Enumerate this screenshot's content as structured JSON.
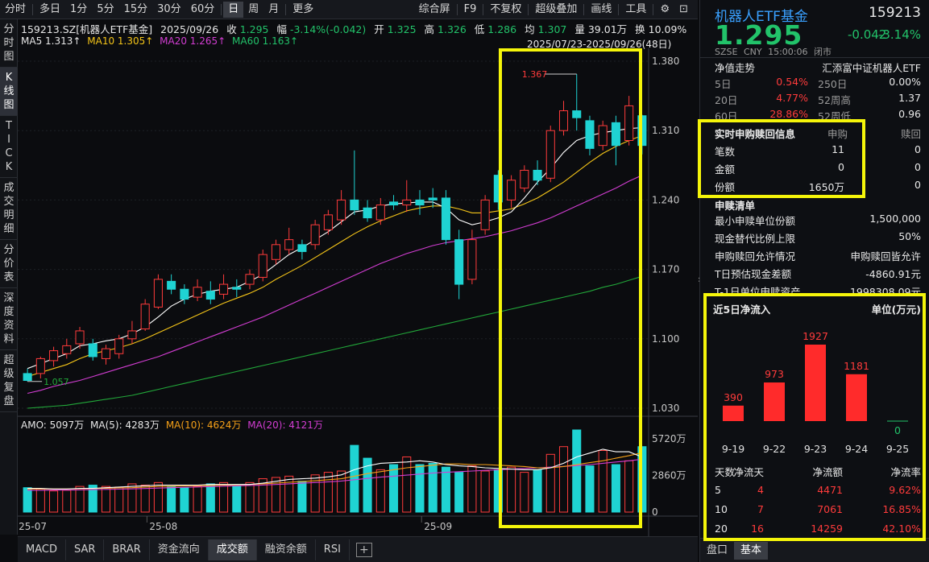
{
  "toolbar": {
    "periods": [
      "分时",
      "多日",
      "1分",
      "5分",
      "15分",
      "30分",
      "60分",
      "日",
      "周",
      "月",
      "更多"
    ],
    "active_period": "日",
    "right_items": [
      "综合屏",
      "F9",
      "不复权",
      "超级叠加",
      "画线",
      "工具"
    ]
  },
  "vtabs": [
    "分时图",
    "K线图",
    "TICK",
    "成交明细",
    "分价表",
    "深度资料",
    "超级复盘"
  ],
  "quote_line": {
    "code_name": "159213.SZ[机器人ETF基金]",
    "date": "2025/09/26",
    "close_label": "收",
    "close": "1.295",
    "chg_label": "幅",
    "chg": "-3.14%(-0.042)",
    "open_label": "开",
    "open": "1.325",
    "high_label": "高",
    "high": "1.326",
    "low_label": "低",
    "low": "1.286",
    "avg_label": "均",
    "avg": "1.307",
    "vol_label": "量",
    "vol": "39.01万",
    "turnover_label": "换",
    "turnover": "10.09%"
  },
  "ma_line": {
    "ma5": "MA5 1.313↑",
    "ma10": "MA10 1.305↑",
    "ma20": "MA20 1.265↑",
    "ma60": "MA60 1.163↑",
    "range": "2025/07/23-2025/09/26(48日)"
  },
  "price_axis": [
    "1.380",
    "1.310",
    "1.240",
    "1.170",
    "1.100",
    "1.030"
  ],
  "annotations": {
    "high": "1.367",
    "low": "1.057"
  },
  "amo_line": {
    "amo": "AMO: 5097万",
    "ma5": "MA(5): 4283万",
    "ma10": "MA(10): 4624万",
    "ma20": "MA(20): 4121万"
  },
  "vol_axis": [
    "5720万",
    "2860万",
    "0"
  ],
  "date_axis": [
    "25-07",
    "25-08",
    "25-09"
  ],
  "bottom_tabs": [
    "MACD",
    "SAR",
    "BRAR",
    "资金流向",
    "成交额",
    "融资余额",
    "RSI"
  ],
  "active_bottom_tab": "成交额",
  "colors": {
    "up": "#ff3b3b",
    "down": "#1fd3d3",
    "ma5": "#ffffff",
    "ma10": "#f5c518",
    "ma20": "#d23dd2",
    "ma60": "#22a83a",
    "highlight": "#f5f50a"
  },
  "chart_data": {
    "type": "candlestick",
    "ylim": [
      1.03,
      1.38
    ],
    "candles": [
      {
        "o": 1.065,
        "c": 1.058,
        "h": 1.07,
        "l": 1.057
      },
      {
        "o": 1.065,
        "c": 1.08,
        "h": 1.082,
        "l": 1.06
      },
      {
        "o": 1.078,
        "c": 1.088,
        "h": 1.092,
        "l": 1.072
      },
      {
        "o": 1.085,
        "c": 1.093,
        "h": 1.1,
        "l": 1.08
      },
      {
        "o": 1.095,
        "c": 1.108,
        "h": 1.112,
        "l": 1.09
      },
      {
        "o": 1.095,
        "c": 1.082,
        "h": 1.1,
        "l": 1.078
      },
      {
        "o": 1.08,
        "c": 1.09,
        "h": 1.094,
        "l": 1.074
      },
      {
        "o": 1.085,
        "c": 1.1,
        "h": 1.104,
        "l": 1.08
      },
      {
        "o": 1.1,
        "c": 1.108,
        "h": 1.118,
        "l": 1.095
      },
      {
        "o": 1.11,
        "c": 1.135,
        "h": 1.14,
        "l": 1.108
      },
      {
        "o": 1.132,
        "c": 1.16,
        "h": 1.165,
        "l": 1.13
      },
      {
        "o": 1.158,
        "c": 1.15,
        "h": 1.165,
        "l": 1.145
      },
      {
        "o": 1.15,
        "c": 1.14,
        "h": 1.155,
        "l": 1.135
      },
      {
        "o": 1.142,
        "c": 1.152,
        "h": 1.16,
        "l": 1.138
      },
      {
        "o": 1.148,
        "c": 1.14,
        "h": 1.158,
        "l": 1.135
      },
      {
        "o": 1.145,
        "c": 1.155,
        "h": 1.165,
        "l": 1.14
      },
      {
        "o": 1.152,
        "c": 1.15,
        "h": 1.16,
        "l": 1.142
      },
      {
        "o": 1.155,
        "c": 1.165,
        "h": 1.17,
        "l": 1.15
      },
      {
        "o": 1.162,
        "c": 1.185,
        "h": 1.19,
        "l": 1.158
      },
      {
        "o": 1.18,
        "c": 1.195,
        "h": 1.2,
        "l": 1.175
      },
      {
        "o": 1.19,
        "c": 1.2,
        "h": 1.212,
        "l": 1.185
      },
      {
        "o": 1.195,
        "c": 1.188,
        "h": 1.2,
        "l": 1.18
      },
      {
        "o": 1.195,
        "c": 1.215,
        "h": 1.22,
        "l": 1.19
      },
      {
        "o": 1.21,
        "c": 1.225,
        "h": 1.23,
        "l": 1.205
      },
      {
        "o": 1.22,
        "c": 1.24,
        "h": 1.25,
        "l": 1.215
      },
      {
        "o": 1.24,
        "c": 1.23,
        "h": 1.29,
        "l": 1.225
      },
      {
        "o": 1.232,
        "c": 1.222,
        "h": 1.24,
        "l": 1.218
      },
      {
        "o": 1.22,
        "c": 1.235,
        "h": 1.242,
        "l": 1.215
      },
      {
        "o": 1.238,
        "c": 1.235,
        "h": 1.245,
        "l": 1.23
      },
      {
        "o": 1.235,
        "c": 1.24,
        "h": 1.26,
        "l": 1.228
      },
      {
        "o": 1.24,
        "c": 1.235,
        "h": 1.25,
        "l": 1.225
      },
      {
        "o": 1.242,
        "c": 1.24,
        "h": 1.252,
        "l": 1.232
      },
      {
        "o": 1.242,
        "c": 1.2,
        "h": 1.25,
        "l": 1.195
      },
      {
        "o": 1.2,
        "c": 1.155,
        "h": 1.21,
        "l": 1.14
      },
      {
        "o": 1.16,
        "c": 1.2,
        "h": 1.21,
        "l": 1.155
      },
      {
        "o": 1.21,
        "c": 1.24,
        "h": 1.245,
        "l": 1.205
      },
      {
        "o": 1.265,
        "c": 1.238,
        "h": 1.27,
        "l": 1.23
      },
      {
        "o": 1.24,
        "c": 1.26,
        "h": 1.265,
        "l": 1.232
      },
      {
        "o": 1.252,
        "c": 1.27,
        "h": 1.275,
        "l": 1.248
      },
      {
        "o": 1.27,
        "c": 1.26,
        "h": 1.28,
        "l": 1.255
      },
      {
        "o": 1.262,
        "c": 1.31,
        "h": 1.315,
        "l": 1.258
      },
      {
        "o": 1.31,
        "c": 1.33,
        "h": 1.34,
        "l": 1.305
      },
      {
        "o": 1.33,
        "c": 1.323,
        "h": 1.367,
        "l": 1.31
      },
      {
        "o": 1.32,
        "c": 1.292,
        "h": 1.325,
        "l": 1.285
      },
      {
        "o": 1.295,
        "c": 1.315,
        "h": 1.32,
        "l": 1.29
      },
      {
        "o": 1.318,
        "c": 1.295,
        "h": 1.325,
        "l": 1.275
      },
      {
        "o": 1.3,
        "c": 1.335,
        "h": 1.345,
        "l": 1.295
      },
      {
        "o": 1.325,
        "c": 1.295,
        "h": 1.326,
        "l": 1.286
      }
    ],
    "amount_wan": [
      1900,
      1800,
      1650,
      1700,
      2000,
      2100,
      2000,
      1950,
      2200,
      2100,
      2300,
      2000,
      1900,
      2000,
      2200,
      2300,
      2050,
      2300,
      2600,
      2700,
      2800,
      2400,
      2900,
      3100,
      3200,
      5200,
      4200,
      3300,
      3700,
      4300,
      3700,
      3800,
      3500,
      3100,
      3600,
      3200,
      3300,
      3500,
      3100,
      3300,
      4500,
      5100,
      6400,
      3600,
      4800,
      3700,
      4000,
      5100
    ],
    "ma5": [
      1.07,
      1.075,
      1.08,
      1.085,
      1.093,
      1.095,
      1.098,
      1.1,
      1.105,
      1.112,
      1.122,
      1.133,
      1.14,
      1.145,
      1.148,
      1.15,
      1.152,
      1.158,
      1.165,
      1.175,
      1.185,
      1.192,
      1.2,
      1.208,
      1.218,
      1.228,
      1.23,
      1.234,
      1.236,
      1.237,
      1.238,
      1.238,
      1.232,
      1.22,
      1.215,
      1.218,
      1.222,
      1.228,
      1.242,
      1.258,
      1.272,
      1.288,
      1.3,
      1.305,
      1.308,
      1.31,
      1.312,
      1.313
    ],
    "ma10": [
      1.062,
      1.066,
      1.07,
      1.074,
      1.08,
      1.085,
      1.088,
      1.091,
      1.095,
      1.1,
      1.106,
      1.112,
      1.118,
      1.124,
      1.13,
      1.136,
      1.141,
      1.146,
      1.152,
      1.16,
      1.167,
      1.174,
      1.182,
      1.19,
      1.198,
      1.206,
      1.213,
      1.219,
      1.224,
      1.229,
      1.232,
      1.234,
      1.234,
      1.231,
      1.227,
      1.227,
      1.229,
      1.231,
      1.236,
      1.242,
      1.25,
      1.258,
      1.268,
      1.278,
      1.287,
      1.294,
      1.3,
      1.305
    ],
    "ma20": [
      1.045,
      1.048,
      1.052,
      1.055,
      1.058,
      1.062,
      1.066,
      1.07,
      1.074,
      1.078,
      1.082,
      1.087,
      1.092,
      1.097,
      1.102,
      1.107,
      1.112,
      1.117,
      1.122,
      1.128,
      1.134,
      1.14,
      1.146,
      1.152,
      1.158,
      1.164,
      1.17,
      1.176,
      1.181,
      1.186,
      1.19,
      1.194,
      1.197,
      1.199,
      1.201,
      1.203,
      1.206,
      1.209,
      1.213,
      1.217,
      1.222,
      1.228,
      1.234,
      1.24,
      1.246,
      1.252,
      1.259,
      1.265
    ],
    "ma60": [
      1.03,
      1.031,
      1.032,
      1.033,
      1.035,
      1.037,
      1.039,
      1.041,
      1.043,
      1.046,
      1.049,
      1.052,
      1.055,
      1.058,
      1.061,
      1.064,
      1.067,
      1.07,
      1.073,
      1.076,
      1.079,
      1.082,
      1.085,
      1.088,
      1.091,
      1.094,
      1.097,
      1.1,
      1.103,
      1.106,
      1.109,
      1.112,
      1.115,
      1.118,
      1.121,
      1.124,
      1.127,
      1.13,
      1.133,
      1.136,
      1.139,
      1.142,
      1.145,
      1.148,
      1.152,
      1.155,
      1.159,
      1.163
    ],
    "amo_ma5": [
      1850,
      1850,
      1800,
      1800,
      1850,
      1850,
      1900,
      1950,
      2000,
      2050,
      2100,
      2100,
      2100,
      2100,
      2150,
      2150,
      2150,
      2150,
      2250,
      2400,
      2550,
      2600,
      2650,
      2750,
      2900,
      3300,
      3600,
      3800,
      3850,
      3900,
      4000,
      3900,
      3700,
      3600,
      3550,
      3450,
      3400,
      3350,
      3300,
      3300,
      3450,
      3800,
      4300,
      4600,
      4900,
      4700,
      4700,
      4283
    ],
    "amo_ma10": [
      1800,
      1800,
      1800,
      1800,
      1820,
      1840,
      1860,
      1880,
      1900,
      1950,
      2000,
      2020,
      2040,
      2060,
      2080,
      2100,
      2120,
      2150,
      2200,
      2260,
      2320,
      2380,
      2440,
      2520,
      2600,
      2800,
      3000,
      3150,
      3300,
      3450,
      3550,
      3650,
      3750,
      3750,
      3700,
      3700,
      3650,
      3600,
      3550,
      3450,
      3450,
      3550,
      3700,
      3850,
      4000,
      4200,
      4400,
      4624
    ],
    "amo_ma20": [
      1700,
      1700,
      1710,
      1720,
      1730,
      1750,
      1770,
      1790,
      1810,
      1840,
      1870,
      1900,
      1930,
      1960,
      1990,
      2020,
      2050,
      2080,
      2110,
      2150,
      2200,
      2250,
      2300,
      2360,
      2420,
      2520,
      2620,
      2720,
      2800,
      2880,
      2960,
      3040,
      3100,
      3150,
      3200,
      3250,
      3300,
      3350,
      3400,
      3450,
      3500,
      3560,
      3620,
      3700,
      3800,
      3900,
      4000,
      4121
    ]
  },
  "right": {
    "name": "机器人ETF基金",
    "code": "159213",
    "price": "1.295",
    "change": "-0.042",
    "change_pct": "-3.14%",
    "exchange": "SZSE",
    "currency": "CNY",
    "time": "15:00:06",
    "status": "闭市",
    "nav_title": "净值走势",
    "fund_company": "汇添富中证机器人ETF",
    "perf_rows": [
      {
        "k1": "5日",
        "v1": "0.54%",
        "k2": "250日",
        "v2": "0.00%"
      },
      {
        "k1": "20日",
        "v1": "4.77%",
        "k2": "52周高",
        "v2": "1.37"
      },
      {
        "k1": "60日",
        "v1": "28.86%",
        "k2": "52周低",
        "v2": "0.96"
      }
    ],
    "subs": {
      "title": "实时申购赎回信息",
      "col_buy": "申购",
      "col_sell": "赎回",
      "rows": [
        {
          "k": "笔数",
          "buy": "11",
          "sell": "0"
        },
        {
          "k": "金额",
          "buy": "0",
          "sell": "0"
        },
        {
          "k": "份额",
          "buy": "1650万",
          "sell": "0"
        }
      ]
    },
    "list": {
      "title": "申赎清单",
      "rows": [
        {
          "k": "最小申赎单位份额",
          "v": "1,500,000"
        },
        {
          "k": "现金替代比例上限",
          "v": "50%"
        },
        {
          "k": "申购赎回允许情况",
          "v": "申购赎回皆允许"
        },
        {
          "k": "T日预估现金差额",
          "v": "-4860.91元"
        },
        {
          "k": "T-1日单位申赎资产",
          "v": "1998308.09元"
        }
      ]
    },
    "inflow": {
      "title": "近5日净流入",
      "unit": "单位(万元)",
      "dates": [
        "9-19",
        "9-22",
        "9-23",
        "9-24",
        "9-25"
      ],
      "values": [
        390,
        973,
        1927,
        1181,
        0
      ],
      "value_labels": [
        "390",
        "973",
        "1927",
        "1181",
        "0"
      ],
      "table_head": [
        "天数",
        "净流天",
        "净流额",
        "净流率"
      ],
      "table_rows": [
        {
          "d": "5",
          "n": "4",
          "amt": "4471",
          "rate": "9.62%"
        },
        {
          "d": "10",
          "n": "7",
          "amt": "7061",
          "rate": "16.85%"
        },
        {
          "d": "20",
          "n": "16",
          "amt": "14259",
          "rate": "42.10%"
        }
      ]
    },
    "footer_tabs": [
      "盘口",
      "基本"
    ],
    "active_footer_tab": "基本"
  }
}
